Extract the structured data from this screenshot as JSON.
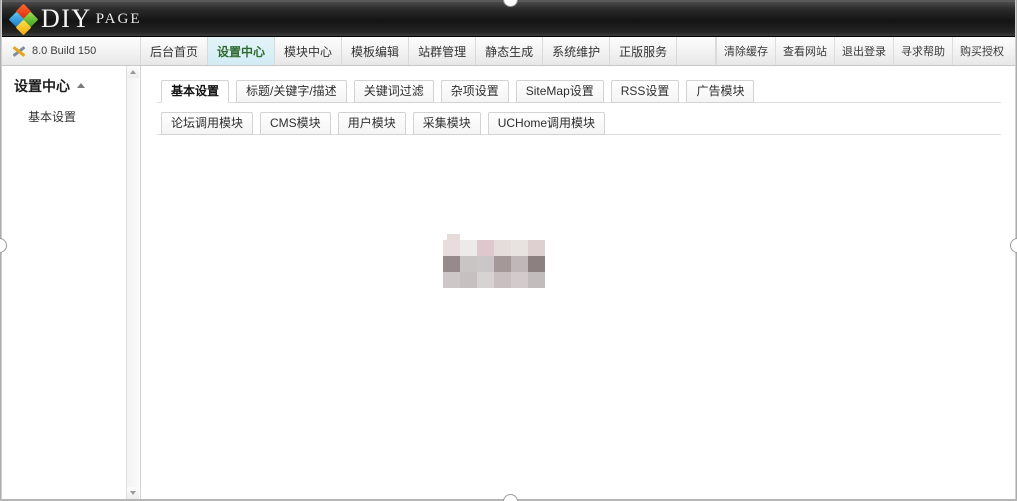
{
  "window": {
    "title": "DIYPAGE"
  },
  "header": {
    "brand_main": "DIY",
    "brand_sub": "PAGE",
    "logo_icon": "diamond-cluster-logo"
  },
  "toolbar": {
    "version_label": "8.0 Build 150",
    "version_icon": "wrench-icon",
    "nav_tabs": [
      {
        "label": "后台首页",
        "active": false
      },
      {
        "label": "设置中心",
        "active": true
      },
      {
        "label": "模块中心",
        "active": false
      },
      {
        "label": "模板编辑",
        "active": false
      },
      {
        "label": "站群管理",
        "active": false
      },
      {
        "label": "静态生成",
        "active": false
      },
      {
        "label": "系统维护",
        "active": false
      },
      {
        "label": "正版服务",
        "active": false
      }
    ],
    "util_links": [
      {
        "label": "清除缓存"
      },
      {
        "label": "查看网站"
      },
      {
        "label": "退出登录"
      },
      {
        "label": "寻求帮助"
      },
      {
        "label": "购买授权"
      }
    ]
  },
  "sidebar": {
    "title": "设置中心",
    "collapse_icon": "caret-up-icon",
    "items": [
      {
        "label": "基本设置"
      }
    ],
    "scrollbar": {
      "up_icon": "scroll-up-arrow-icon",
      "down_icon": "scroll-down-arrow-icon"
    }
  },
  "content": {
    "tab_rows": [
      [
        {
          "label": "基本设置",
          "active": true
        },
        {
          "label": "标题/关键字/描述",
          "active": false
        },
        {
          "label": "关键词过滤",
          "active": false
        },
        {
          "label": "杂项设置",
          "active": false
        },
        {
          "label": "SiteMap设置",
          "active": false
        },
        {
          "label": "RSS设置",
          "active": false
        },
        {
          "label": "广告模块",
          "active": false
        }
      ],
      [
        {
          "label": "论坛调用模块",
          "active": false
        },
        {
          "label": "CMS模块",
          "active": false
        },
        {
          "label": "用户模块",
          "active": false
        },
        {
          "label": "采集模块",
          "active": false
        },
        {
          "label": "UCHome调用模块",
          "active": false
        }
      ]
    ],
    "censored_region": {
      "label": "pixelated-redacted-content",
      "colors": [
        [
          "#e8dcdc",
          "#edeaea",
          "#dfc8cd",
          "#e4dddc",
          "#e8e2e1",
          "#ded0d1"
        ],
        [
          "#968b8b",
          "#c9c5c5",
          "#cbc6c7",
          "#a49898",
          "#bfb8b9",
          "#8d8080"
        ],
        [
          "#cdc7c8",
          "#c6c0c1",
          "#d7d3d3",
          "#c9bfc0",
          "#d1cbcb",
          "#c3bcbd"
        ]
      ]
    }
  },
  "colors": {
    "header_bg": "#141414",
    "active_nav_bg": "#d2ecf4",
    "active_nav_text": "#2f6b2f",
    "toolbar_bg": "#f3f3f3",
    "border": "#d3d3d3"
  }
}
